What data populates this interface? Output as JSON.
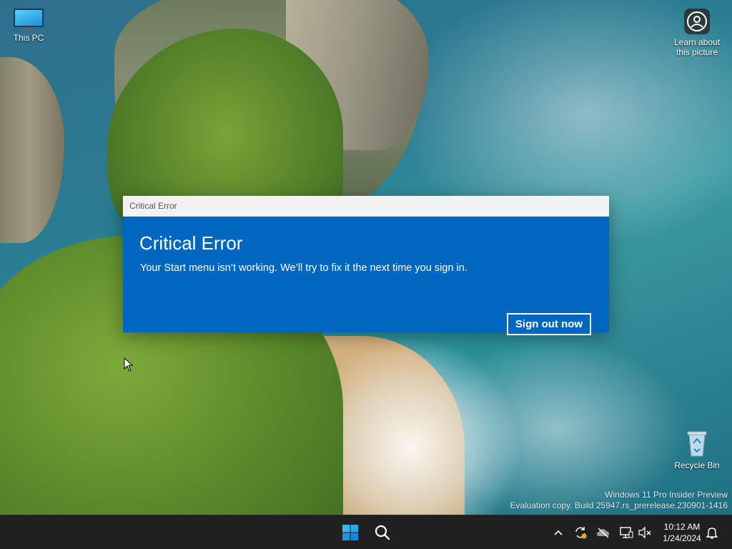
{
  "desktop": {
    "icons": [
      {
        "label": "This PC"
      },
      {
        "label": "Learn about\nthis picture"
      },
      {
        "label": "Recycle Bin"
      }
    ],
    "watermark": {
      "line1": "Windows 11 Pro Insider Preview",
      "line2": "Evaluation copy. Build 25947.rs_prerelease.230901-1416"
    }
  },
  "dialog": {
    "window_title": "Critical Error",
    "heading": "Critical Error",
    "message": "Your Start menu isn’t working. We’ll try to fix it the next time you sign in.",
    "button_label": "Sign out now",
    "accent_color": "#0067c0"
  },
  "taskbar": {
    "center_icons": [
      "windows-start-icon",
      "search-icon"
    ],
    "tray_icons": [
      "chevron-up-icon",
      "update-sync-icon",
      "onedrive-off-icon",
      "network-icon",
      "volume-muted-icon"
    ],
    "clock": {
      "time": "10:12 AM",
      "date": "1/24/2024"
    },
    "notification_icon": "bell-icon"
  }
}
